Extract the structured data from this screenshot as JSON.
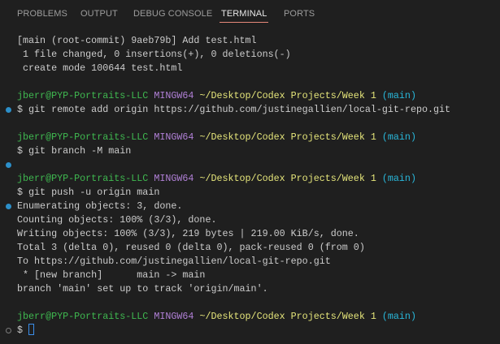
{
  "tabs": [
    {
      "label": "PROBLEMS"
    },
    {
      "label": "OUTPUT"
    },
    {
      "label": "DEBUG CONSOLE"
    },
    {
      "label": "TERMINAL",
      "active": true
    },
    {
      "label": "PORTS"
    }
  ],
  "colors": {
    "accent_underline": "#e7887a",
    "decoration_blue": "#2c8fc9",
    "background": "#1f1f1f"
  },
  "terminal": {
    "lines": [
      {
        "deco": "",
        "segs": [
          {
            "t": "[main (root-commit) 9aeb79b] Add test.html",
            "c": ""
          }
        ]
      },
      {
        "deco": "",
        "segs": [
          {
            "t": " 1 file changed, 0 insertions(+), 0 deletions(-)",
            "c": ""
          }
        ]
      },
      {
        "deco": "",
        "segs": [
          {
            "t": " create mode 100644 test.html",
            "c": ""
          }
        ]
      },
      {
        "deco": "",
        "segs": []
      },
      {
        "deco": "",
        "segs": [
          {
            "t": "jberr@PYP-Portraits-LLC ",
            "c": "green"
          },
          {
            "t": "MINGW64 ",
            "c": "purple"
          },
          {
            "t": "~/Desktop/Codex Projects/Week 1 ",
            "c": "yellow"
          },
          {
            "t": "(main)",
            "c": "cyan"
          }
        ]
      },
      {
        "deco": "blue",
        "segs": [
          {
            "t": "$ git remote add origin https://github.com/justinegallien/local-git-repo.git",
            "c": ""
          }
        ]
      },
      {
        "deco": "",
        "segs": []
      },
      {
        "deco": "",
        "segs": [
          {
            "t": "jberr@PYP-Portraits-LLC ",
            "c": "green"
          },
          {
            "t": "MINGW64 ",
            "c": "purple"
          },
          {
            "t": "~/Desktop/Codex Projects/Week 1 ",
            "c": "yellow"
          },
          {
            "t": "(main)",
            "c": "cyan"
          }
        ]
      },
      {
        "deco": "",
        "segs": [
          {
            "t": "$ git branch -M main",
            "c": ""
          }
        ]
      },
      {
        "deco": "blue",
        "segs": []
      },
      {
        "deco": "",
        "segs": [
          {
            "t": "jberr@PYP-Portraits-LLC ",
            "c": "green"
          },
          {
            "t": "MINGW64 ",
            "c": "purple"
          },
          {
            "t": "~/Desktop/Codex Projects/Week 1 ",
            "c": "yellow"
          },
          {
            "t": "(main)",
            "c": "cyan"
          }
        ]
      },
      {
        "deco": "",
        "segs": [
          {
            "t": "$ git push -u origin main",
            "c": ""
          }
        ]
      },
      {
        "deco": "blue",
        "segs": [
          {
            "t": "Enumerating objects: 3, done.",
            "c": ""
          }
        ]
      },
      {
        "deco": "",
        "segs": [
          {
            "t": "Counting objects: 100% (3/3), done.",
            "c": ""
          }
        ]
      },
      {
        "deco": "",
        "segs": [
          {
            "t": "Writing objects: 100% (3/3), 219 bytes | 219.00 KiB/s, done.",
            "c": ""
          }
        ]
      },
      {
        "deco": "",
        "segs": [
          {
            "t": "Total 3 (delta 0), reused 0 (delta 0), pack-reused 0 (from 0)",
            "c": ""
          }
        ]
      },
      {
        "deco": "",
        "segs": [
          {
            "t": "To https://github.com/justinegallien/local-git-repo.git",
            "c": ""
          }
        ]
      },
      {
        "deco": "",
        "segs": [
          {
            "t": " * [new branch]      main -> main",
            "c": ""
          }
        ]
      },
      {
        "deco": "",
        "segs": [
          {
            "t": "branch 'main' set up to track 'origin/main'.",
            "c": ""
          }
        ]
      },
      {
        "deco": "",
        "segs": []
      },
      {
        "deco": "",
        "segs": [
          {
            "t": "jberr@PYP-Portraits-LLC ",
            "c": "green"
          },
          {
            "t": "MINGW64 ",
            "c": "purple"
          },
          {
            "t": "~/Desktop/Codex Projects/Week 1 ",
            "c": "yellow"
          },
          {
            "t": "(main)",
            "c": "cyan"
          }
        ]
      },
      {
        "deco": "gray",
        "segs": [
          {
            "t": "$ ",
            "c": ""
          }
        ],
        "cursor": true
      }
    ]
  }
}
